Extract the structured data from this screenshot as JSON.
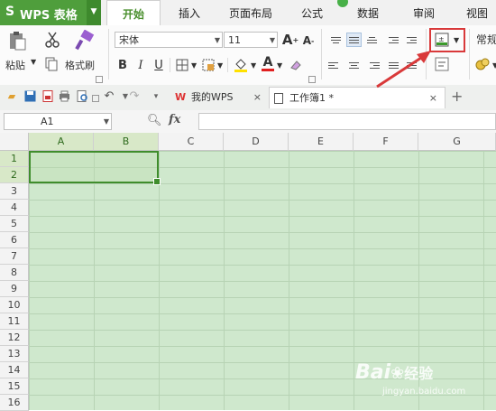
{
  "app": {
    "title": "WPS 表格",
    "logo": "S"
  },
  "menu": {
    "tabs": [
      {
        "label": "开始",
        "active": true
      },
      {
        "label": "插入"
      },
      {
        "label": "页面布局"
      },
      {
        "label": "公式"
      },
      {
        "label": "数据"
      },
      {
        "label": "审阅"
      },
      {
        "label": "视图"
      }
    ]
  },
  "ribbon": {
    "paste_label": "粘贴",
    "format_painter_label": "格式刷",
    "font_name": "宋体",
    "font_size": "11",
    "number_format": "常规",
    "bold": "B",
    "italic": "I",
    "underline": "U",
    "font_color_glyph": "A",
    "grow_font": "A",
    "shrink_font": "A"
  },
  "quickbar": {
    "tabs": [
      {
        "label": "我的WPS"
      },
      {
        "label": "工作簿1 *",
        "active": true
      }
    ],
    "add_tab": "+"
  },
  "formula_bar": {
    "name_box": "A1",
    "fx": "fx",
    "value": ""
  },
  "sheet": {
    "columns": [
      "A",
      "B",
      "C",
      "D",
      "E",
      "F",
      "G"
    ],
    "rows": [
      "1",
      "2",
      "3",
      "4",
      "5",
      "6",
      "7",
      "8",
      "9",
      "10",
      "11",
      "12",
      "13",
      "14",
      "15",
      "16"
    ],
    "selection": "A1:B2"
  },
  "watermark": {
    "brand": "Bai",
    "brand2": "经验",
    "url": "jingyan.baidu.com"
  },
  "colors": {
    "accent": "#4f9e3c",
    "sheet_bg": "#cfe8cd",
    "highlight": "#d9393a"
  }
}
